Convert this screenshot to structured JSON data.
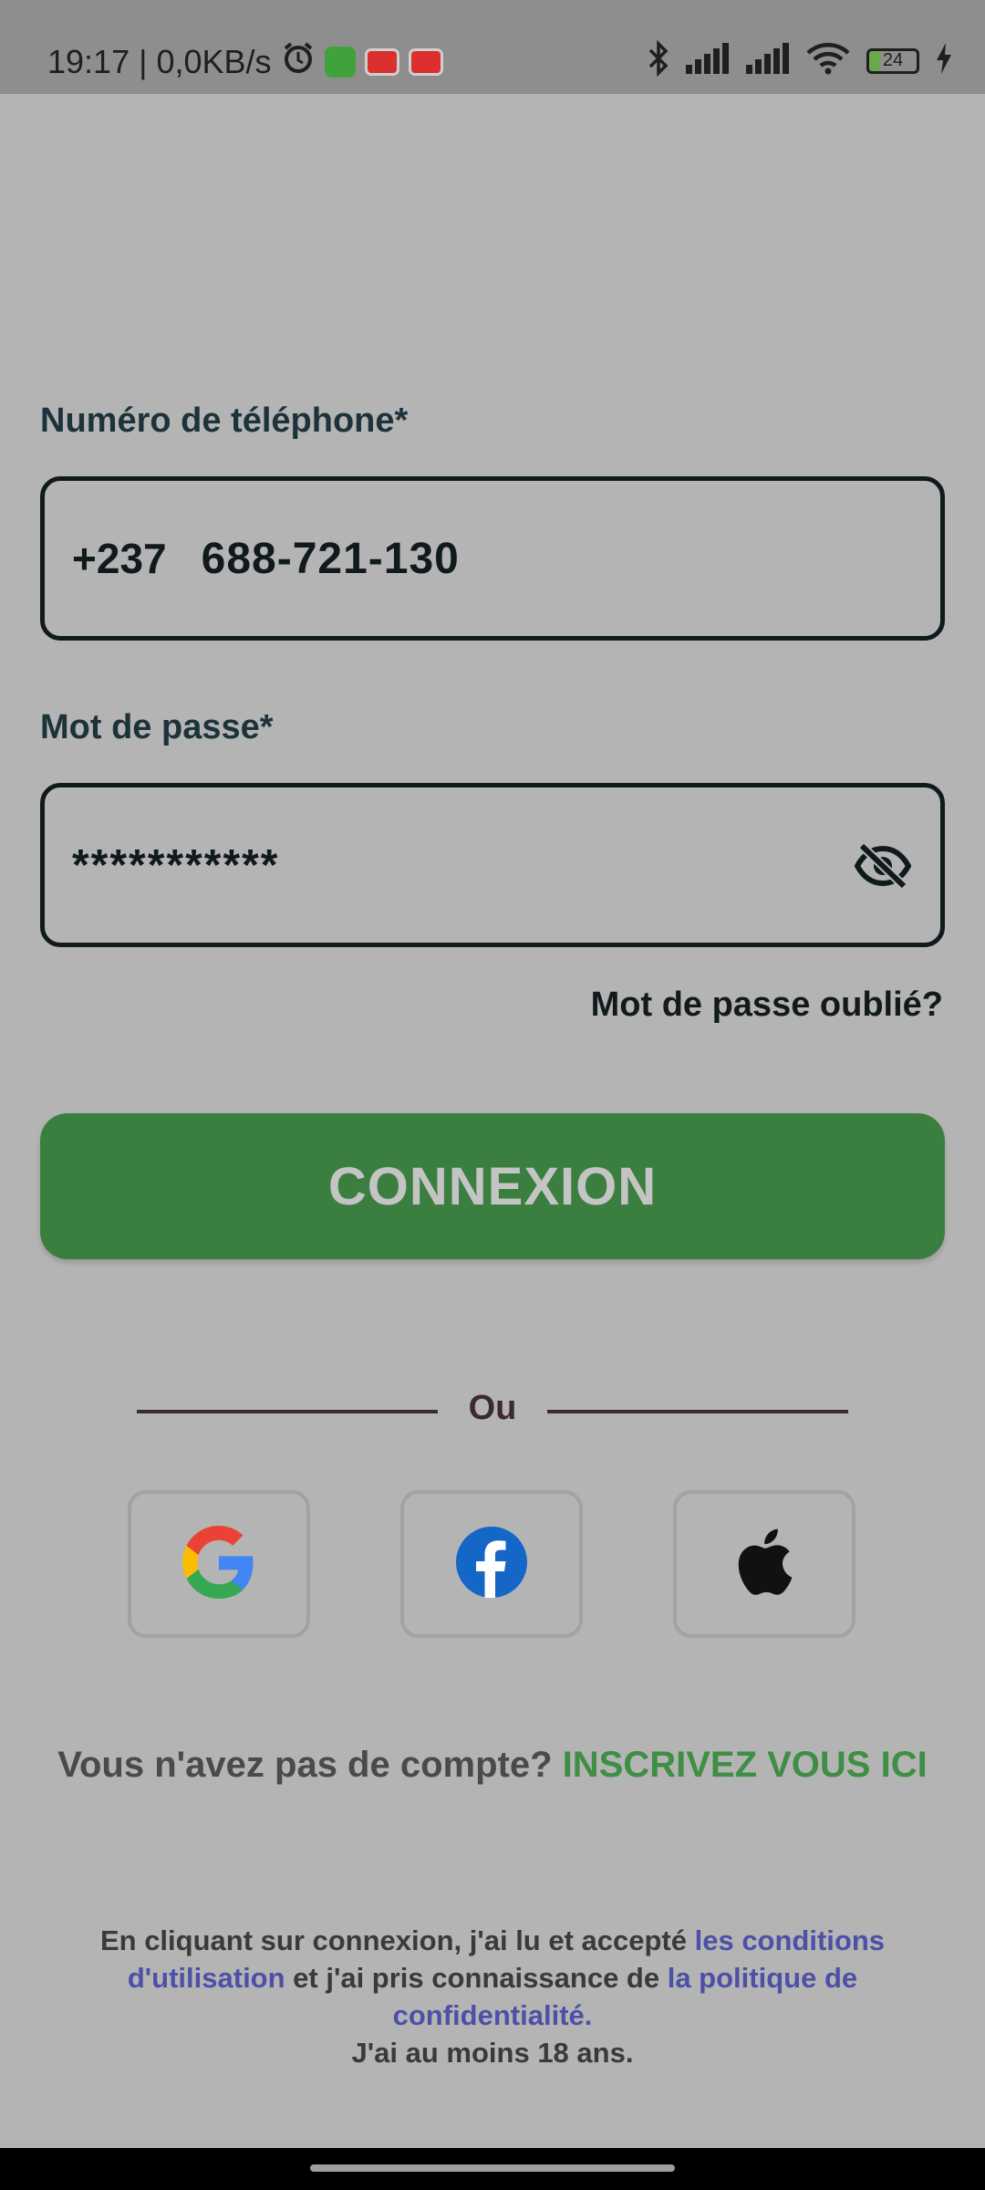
{
  "status_bar": {
    "time_speed": "19:17 | 0,0KB/s",
    "battery": "24"
  },
  "form": {
    "phone_label": "Numéro de téléphone*",
    "phone_prefix": "+237",
    "phone_value": "688-721-130",
    "password_label": "Mot de passe*",
    "password_value": "***********",
    "forgot_password": "Mot de passe oublié?",
    "connect_button": "CONNEXION"
  },
  "separator_text": "Ou",
  "social": {
    "google": "google-icon",
    "facebook": "facebook-icon",
    "apple": "apple-icon"
  },
  "signup": {
    "prompt": "Vous n'avez pas de compte?",
    "link": "INSCRIVEZ VOUS ICI"
  },
  "legal": {
    "part1": "En cliquant sur connexion, j'ai lu et accepté ",
    "terms_link": "les conditions d'utilisation",
    "part2": " et j'ai pris connaissance de ",
    "privacy_link": "la politique de confidentialité.",
    "age": "J'ai au moins 18 ans."
  },
  "colors": {
    "accent_green": "#3a7f40",
    "link_green": "#3e8e44",
    "link_blue": "#4d50a6",
    "background": "#b4b4b4"
  }
}
